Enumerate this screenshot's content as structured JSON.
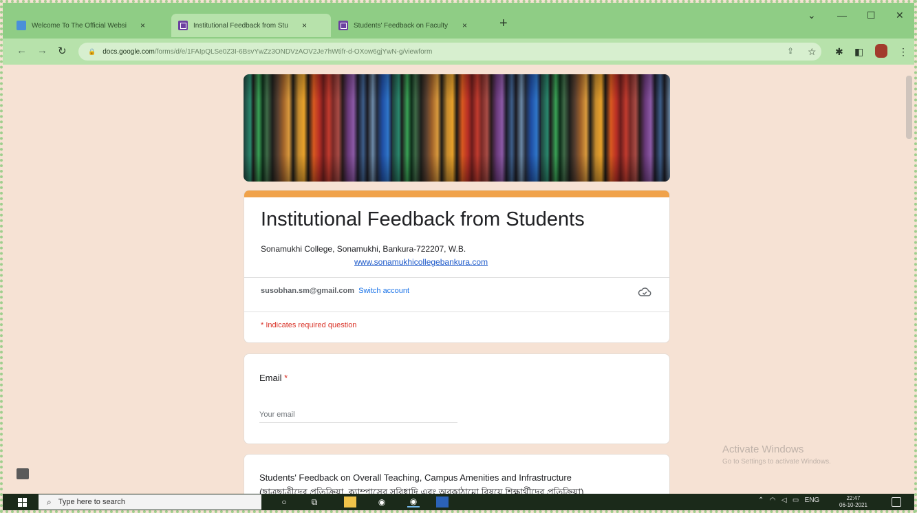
{
  "browser": {
    "tabs": [
      {
        "title": "Welcome To The Official Websi",
        "active": false,
        "favicon": "site-icon"
      },
      {
        "title": "Institutional Feedback from Stu",
        "active": true,
        "favicon": "forms-icon"
      },
      {
        "title": "Students' Feedback on Faculty",
        "active": false,
        "favicon": "forms-icon"
      }
    ],
    "url_host": "docs.google.com",
    "url_path": "/forms/d/e/1FAIpQLSe0Z3I-6BsvYwZz3ONDVzAOV2Je7hWtifr-d-OXow6gjYwN-g/viewform",
    "new_tab_symbol": "+",
    "close_symbol": "×"
  },
  "form": {
    "title": "Institutional Feedback from Students",
    "description": "Sonamukhi College, Sonamukhi, Bankura-722207, W.B.",
    "link_text": "www.sonamukhicollegebankura.com",
    "account_email": "susobhan.sm@gmail.com",
    "switch_account": "Switch account",
    "required_note": "* Indicates required question",
    "email_label": "Email",
    "required_star": " *",
    "email_placeholder": "Your email",
    "section_title": "Students' Feedback on Overall Teaching, Campus Amenities and Infrastructure",
    "section_subtitle": "(ছাত্রছাত্রীদের প্রতিক্রিয়া, ক্যাম্পাসের সুবিধাদি এবং অবকাঠামো বিষয়ে শিক্ষার্থীদের প্রতিক্রিয়া)"
  },
  "watermark": {
    "title": "Activate Windows",
    "subtitle": "Go to Settings to activate Windows."
  },
  "taskbar": {
    "search_placeholder": "Type here to search",
    "language": "ENG",
    "time": "22:47",
    "date": "06-10-2021"
  },
  "colors": {
    "frame_green": "#8fcd85",
    "active_tab": "#b7e2ab",
    "page_bg": "#f6e2d4",
    "form_accent": "#f0a24a",
    "link_blue": "#1a57c9",
    "required_red": "#d93025"
  }
}
